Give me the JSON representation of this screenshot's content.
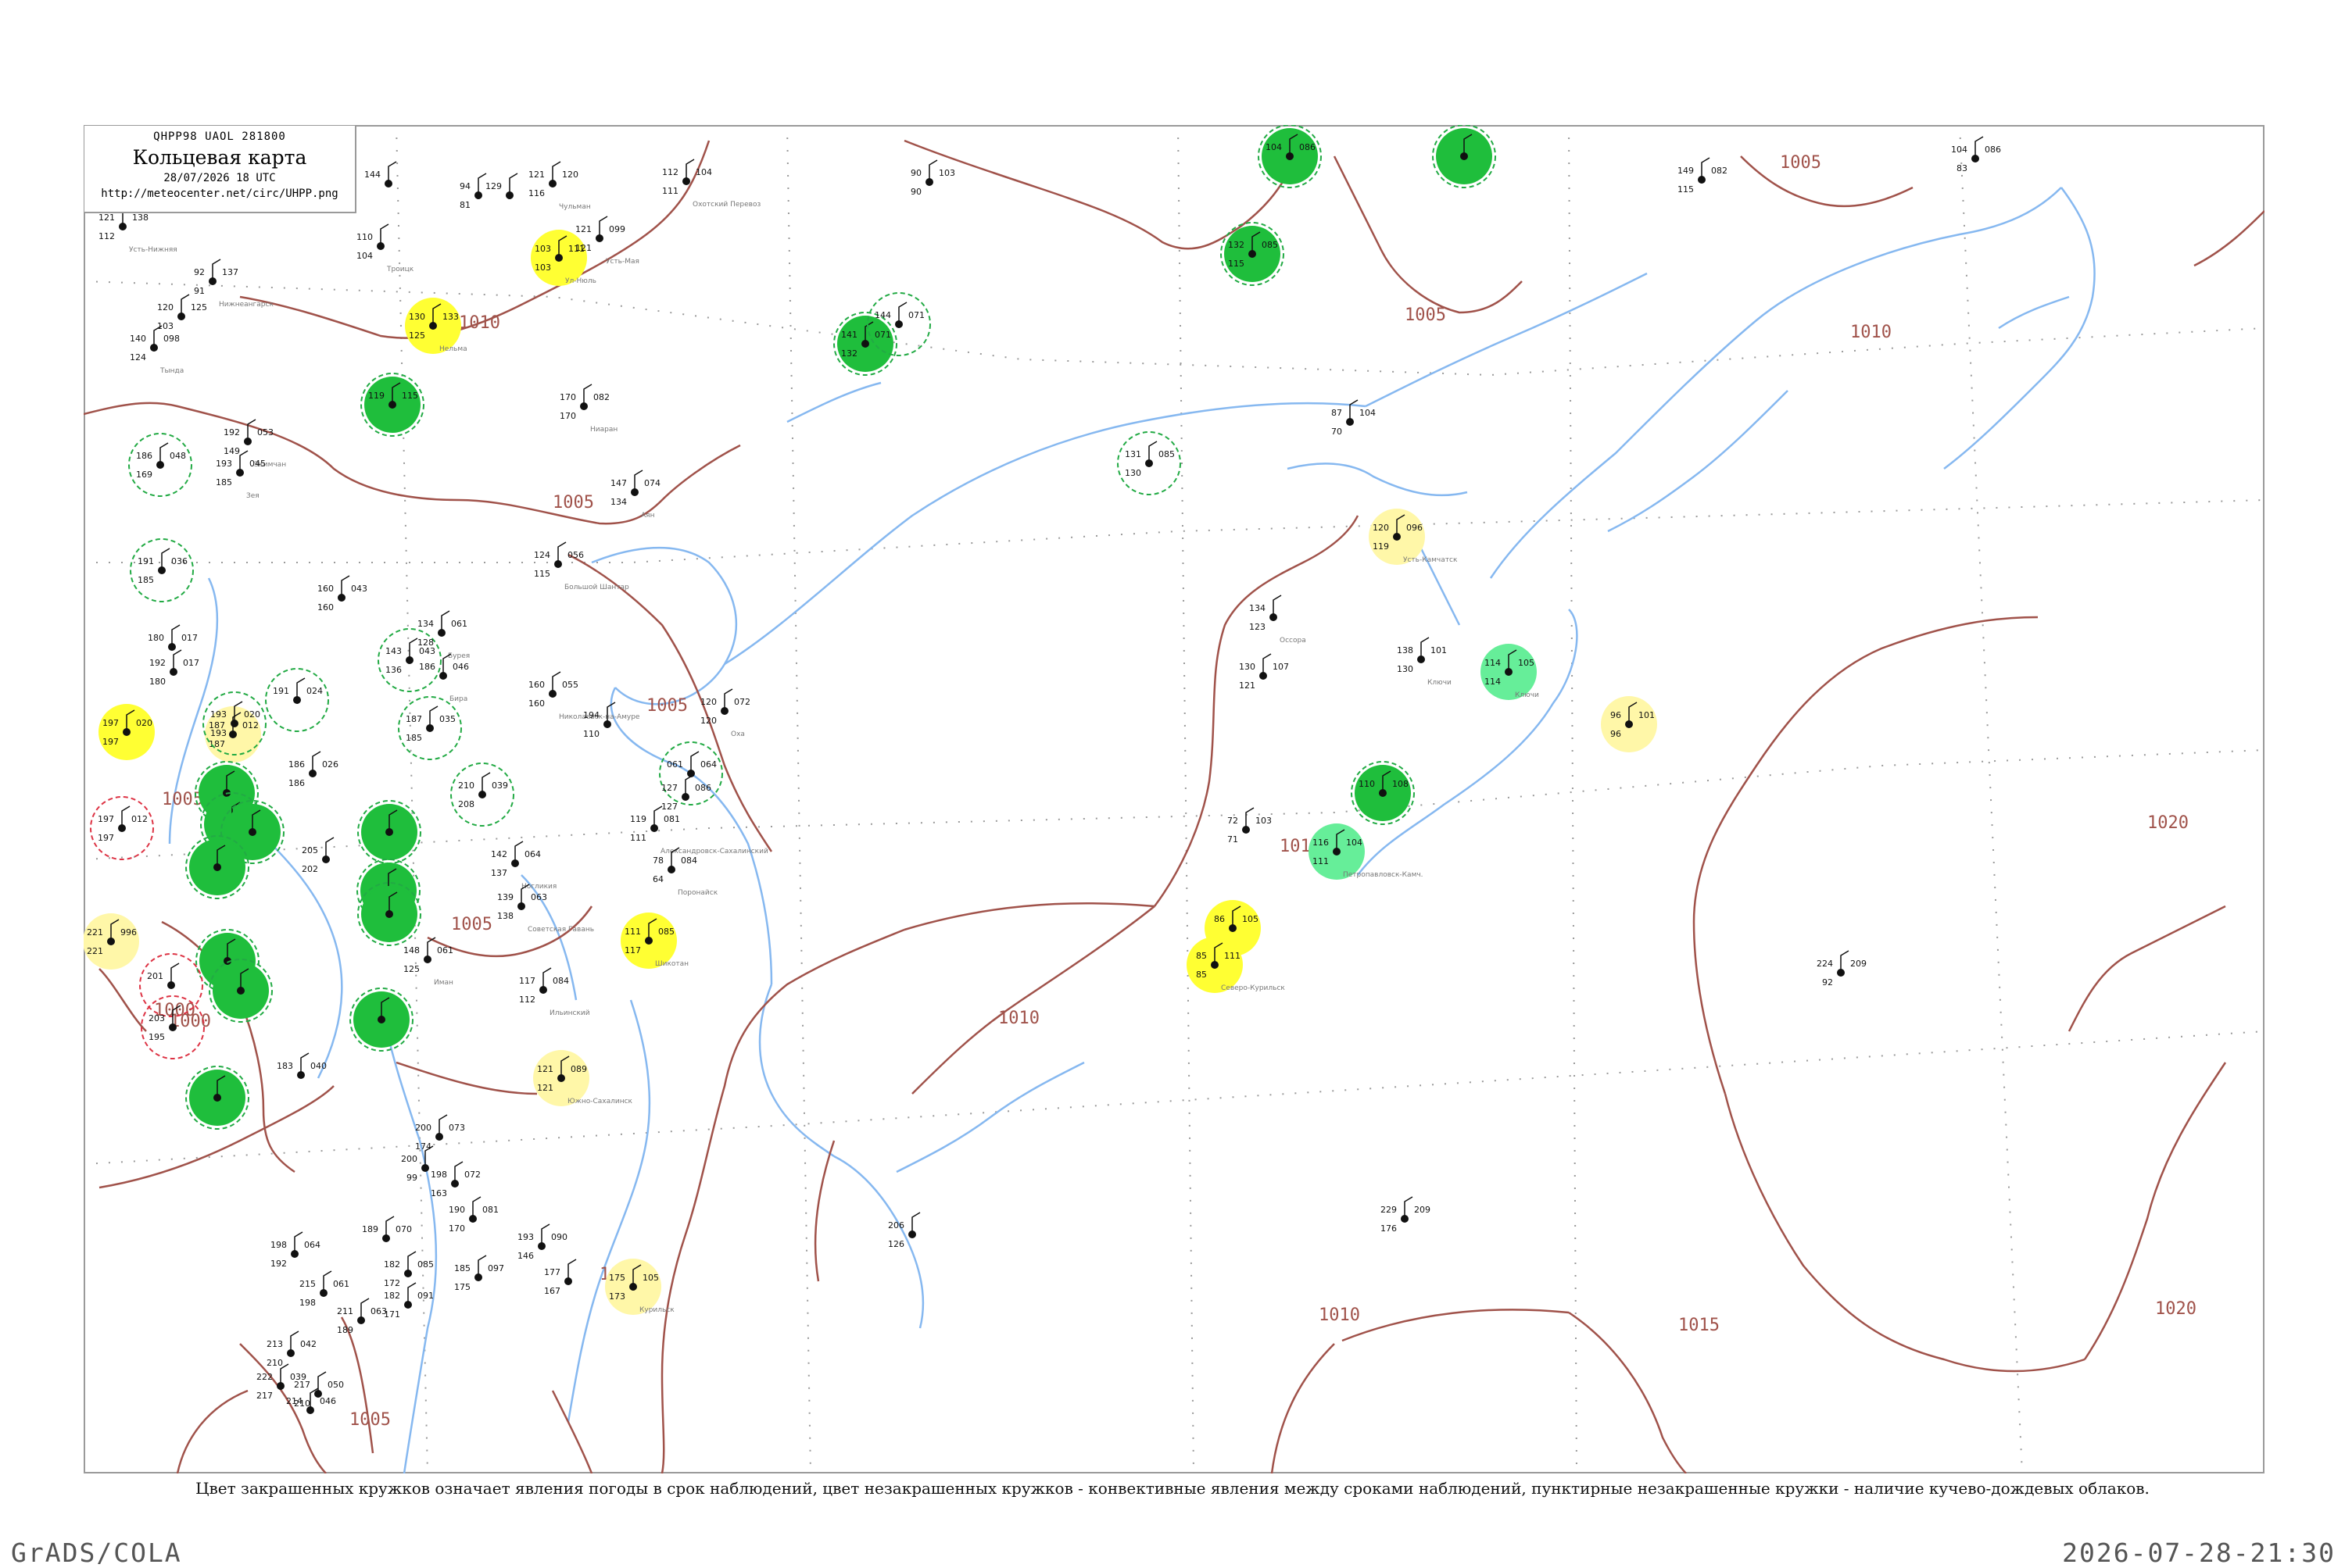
{
  "header": {
    "code": "QHPP98  UAOL  281800",
    "title": "Кольцевая карта",
    "time": "28/07/2026 18 UTC",
    "url": "http://meteocenter.net/circ/UHPP.png"
  },
  "caption": "Цвет закрашенных кружков означает явления погоды в срок наблюдений, цвет незакрашенных кружков - конвективные явления между сроками наблюдений, пунктирные незакрашенные кружки - наличие кучево-дождевых облаков.",
  "footer": {
    "left": "GrADS/COLA",
    "right": "2026-07-28-21:30"
  },
  "colors": {
    "isobar": "#a0524a",
    "coast": "#86b8f0",
    "green": "#1fbe3c",
    "yellow": "#ffff33",
    "pale_yellow": "#fff7a8",
    "light_green": "#66ee99"
  },
  "isobars": {
    "labels": [
      "1010",
      "1005",
      "1005",
      "1005",
      "1005",
      "1005",
      "1005",
      "1005",
      "1010",
      "1010",
      "1010",
      "1010",
      "1015",
      "1020",
      "1020",
      "1000",
      "1000",
      "1010"
    ]
  },
  "stations": [
    {
      "p": "130",
      "t": "133",
      "d": "125",
      "n": "Нельма",
      "fill": "yellow"
    },
    {
      "p": "103",
      "t": "111",
      "d": "103",
      "n": "Ул-Нюль",
      "fill": "yellow"
    },
    {
      "p": "119",
      "t": "115",
      "d": "",
      "n": "",
      "fill": "green"
    },
    {
      "p": "141",
      "t": "071",
      "d": "132",
      "n": "",
      "fill": "green"
    },
    {
      "p": "132",
      "t": "085",
      "d": "115",
      "n": "",
      "fill": "green"
    },
    {
      "p": "104",
      "t": "086",
      "d": "",
      "n": "",
      "fill": "green"
    },
    {
      "p": "",
      "t": "",
      "d": "",
      "n": "",
      "fill": "green"
    },
    {
      "p": "120",
      "t": "096",
      "d": "119",
      "n": "Усть-Камчатск",
      "fill": "pale_yellow"
    },
    {
      "p": "114",
      "t": "105",
      "d": "114",
      "n": "Ключи",
      "fill": "light_green"
    },
    {
      "p": "96",
      "t": "101",
      "d": "96",
      "n": "",
      "fill": "pale_yellow"
    },
    {
      "p": "110",
      "t": "108",
      "d": "",
      "n": "",
      "fill": "green"
    },
    {
      "p": "116",
      "t": "104",
      "d": "111",
      "n": "Петропавловск-Камч.",
      "fill": "light_green"
    },
    {
      "p": "86",
      "t": "105",
      "d": "",
      "n": "",
      "fill": "yellow"
    },
    {
      "p": "85",
      "t": "111",
      "d": "85",
      "n": "Северо-Курильск",
      "fill": "yellow"
    },
    {
      "p": "111",
      "t": "085",
      "d": "117",
      "n": "Шикотан",
      "fill": "yellow"
    },
    {
      "p": "121",
      "t": "089",
      "d": "121",
      "n": "Южно-Сахалинск",
      "fill": "pale_yellow"
    },
    {
      "p": "175",
      "t": "105",
      "d": "173",
      "n": "Курильск",
      "fill": "pale_yellow"
    },
    {
      "p": "197",
      "t": "020",
      "d": "197",
      "n": "",
      "fill": "yellow"
    },
    {
      "p": "187",
      "t": "012",
      "d": "187",
      "n": "",
      "fill": "pale_yellow"
    },
    {
      "p": "221",
      "t": "996",
      "d": "221",
      "n": "",
      "fill": "pale_yellow"
    },
    {
      "p": "",
      "t": "",
      "d": "",
      "n": "",
      "fill": "green"
    },
    {
      "p": "",
      "t": "",
      "d": "",
      "n": "",
      "fill": "green"
    },
    {
      "p": "",
      "t": "",
      "d": "",
      "n": "",
      "fill": "green"
    },
    {
      "p": "",
      "t": "",
      "d": "",
      "n": "",
      "fill": "green"
    },
    {
      "p": "",
      "t": "",
      "d": "",
      "n": "",
      "fill": "green"
    },
    {
      "p": "",
      "t": "",
      "d": "",
      "n": "",
      "fill": "green"
    },
    {
      "p": "",
      "t": "",
      "d": "",
      "n": "",
      "fill": "green"
    },
    {
      "p": "",
      "t": "",
      "d": "",
      "n": "",
      "fill": "green"
    },
    {
      "p": "",
      "t": "",
      "d": "",
      "n": "",
      "fill": "green"
    },
    {
      "p": "",
      "t": "",
      "d": "",
      "n": "",
      "fill": "green"
    },
    {
      "p": "",
      "t": "",
      "d": "",
      "n": "",
      "fill": "green"
    }
  ],
  "unfilled_stations": [
    {
      "p": "186",
      "t": "048",
      "d": "169",
      "n": "",
      "ring": "green"
    },
    {
      "p": "191",
      "t": "036",
      "d": "185",
      "n": "",
      "ring": "green"
    },
    {
      "p": "143",
      "t": "043",
      "d": "136",
      "n": "",
      "ring": "green"
    },
    {
      "p": "187",
      "t": "035",
      "d": "185",
      "n": "",
      "ring": "green"
    },
    {
      "p": "210",
      "t": "039",
      "d": "208",
      "n": "",
      "ring": "green"
    },
    {
      "p": "193",
      "t": "020",
      "d": "193",
      "n": "",
      "ring": "green"
    },
    {
      "p": "191",
      "t": "024",
      "d": "",
      "n": "",
      "ring": "green"
    },
    {
      "p": "131",
      "t": "085",
      "d": "130",
      "n": "",
      "ring": "green"
    },
    {
      "p": "144",
      "t": "071",
      "d": "",
      "n": "",
      "ring": "green"
    },
    {
      "p": "061",
      "t": "064",
      "d": "",
      "n": "",
      "ring": "green"
    },
    {
      "p": "197",
      "t": "012",
      "d": "197",
      "n": "",
      "ring": "red"
    },
    {
      "p": "201",
      "t": "",
      "d": "",
      "n": "",
      "ring": "red"
    },
    {
      "p": "203",
      "t": "",
      "d": "195",
      "n": "",
      "ring": "red"
    }
  ],
  "plain_stations": [
    {
      "p": "121",
      "t": "138",
      "d": "112",
      "n": "Усть-Нижняя"
    },
    {
      "p": "92",
      "t": "137",
      "d": "91",
      "n": "Нижнеангарск"
    },
    {
      "p": "120",
      "t": "125",
      "d": "103",
      "n": ""
    },
    {
      "p": "140",
      "t": "098",
      "d": "124",
      "n": "Тында"
    },
    {
      "p": "121",
      "t": "120",
      "d": "116",
      "n": "Чульман"
    },
    {
      "p": "121",
      "t": "099",
      "d": "121",
      "n": "Усть-Мая"
    },
    {
      "p": "112",
      "t": "104",
      "d": "111",
      "n": "Охотский Перевоз"
    },
    {
      "p": "90",
      "t": "103",
      "d": "90",
      "n": ""
    },
    {
      "p": "149",
      "t": "082",
      "d": "115",
      "n": ""
    },
    {
      "p": "104",
      "t": "086",
      "d": "83",
      "n": ""
    },
    {
      "p": "110",
      "t": "",
      "d": "104",
      "n": "Троицк"
    },
    {
      "p": "144",
      "t": "",
      "d": "",
      "n": ""
    },
    {
      "p": "94",
      "t": "",
      "d": "81",
      "n": ""
    },
    {
      "p": "129",
      "t": "",
      "d": "",
      "n": ""
    },
    {
      "p": "192",
      "t": "053",
      "d": "149",
      "n": "Экимчан"
    },
    {
      "p": "193",
      "t": "045",
      "d": "185",
      "n": "Зея"
    },
    {
      "p": "170",
      "t": "082",
      "d": "170",
      "n": "Ниаран"
    },
    {
      "p": "147",
      "t": "074",
      "d": "134",
      "n": "Аян"
    },
    {
      "p": "124",
      "t": "056",
      "d": "115",
      "n": "Большой Шантар"
    },
    {
      "p": "160",
      "t": "043",
      "d": "160",
      "n": ""
    },
    {
      "p": "134",
      "t": "061",
      "d": "128",
      "n": "Бурея"
    },
    {
      "p": "186",
      "t": "046",
      "d": "",
      "n": "Бира"
    },
    {
      "p": "160",
      "t": "055",
      "d": "160",
      "n": "Николаевск-на-Амуре"
    },
    {
      "p": "120",
      "t": "072",
      "d": "120",
      "n": "Оха"
    },
    {
      "p": "194",
      "t": "",
      "d": "110",
      "n": ""
    },
    {
      "p": "127",
      "t": "086",
      "d": "127",
      "n": ""
    },
    {
      "p": "119",
      "t": "081",
      "d": "111",
      "n": "Александровск-Сахалинский"
    },
    {
      "p": "142",
      "t": "064",
      "d": "137",
      "n": "Ногликия"
    },
    {
      "p": "139",
      "t": "063",
      "d": "138",
      "n": "Советская Гавань"
    },
    {
      "p": "148",
      "t": "061",
      "d": "125",
      "n": "Иман"
    },
    {
      "p": "117",
      "t": "084",
      "d": "112",
      "n": "Ильинский"
    },
    {
      "p": "78",
      "t": "084",
      "d": "64",
      "n": "Поронайск"
    },
    {
      "p": "134",
      "t": "",
      "d": "123",
      "n": "Оссора"
    },
    {
      "p": "130",
      "t": "107",
      "d": "121",
      "n": ""
    },
    {
      "p": "72",
      "t": "103",
      "d": "71",
      "n": ""
    },
    {
      "p": "138",
      "t": "101",
      "d": "130",
      "n": "Ключи"
    },
    {
      "p": "87",
      "t": "104",
      "d": "70",
      "n": ""
    },
    {
      "p": "224",
      "t": "209",
      "d": "92",
      "n": ""
    },
    {
      "p": "229",
      "t": "209",
      "d": "176",
      "n": ""
    },
    {
      "p": "206",
      "t": "",
      "d": "126",
      "n": ""
    },
    {
      "p": "183",
      "t": "040",
      "d": "",
      "n": ""
    },
    {
      "p": "200",
      "t": "073",
      "d": "174",
      "n": ""
    },
    {
      "p": "200",
      "t": "",
      "d": "99",
      "n": ""
    },
    {
      "p": "198",
      "t": "072",
      "d": "163",
      "n": ""
    },
    {
      "p": "190",
      "t": "081",
      "d": "170",
      "n": ""
    },
    {
      "p": "193",
      "t": "090",
      "d": "146",
      "n": ""
    },
    {
      "p": "185",
      "t": "097",
      "d": "175",
      "n": ""
    },
    {
      "p": "177",
      "t": "",
      "d": "167",
      "n": ""
    },
    {
      "p": "198",
      "t": "064",
      "d": "192",
      "n": ""
    },
    {
      "p": "215",
      "t": "061",
      "d": "198",
      "n": ""
    },
    {
      "p": "211",
      "t": "063",
      "d": "189",
      "n": ""
    },
    {
      "p": "189",
      "t": "070",
      "d": "",
      "n": ""
    },
    {
      "p": "182",
      "t": "085",
      "d": "172",
      "n": ""
    },
    {
      "p": "182",
      "t": "091",
      "d": "171",
      "n": ""
    },
    {
      "p": "213",
      "t": "042",
      "d": "210",
      "n": ""
    },
    {
      "p": "222",
      "t": "039",
      "d": "217",
      "n": ""
    },
    {
      "p": "217",
      "t": "050",
      "d": "210",
      "n": ""
    },
    {
      "p": "214",
      "t": "046",
      "d": "",
      "n": ""
    },
    {
      "p": "180",
      "t": "017",
      "d": "",
      "n": ""
    },
    {
      "p": "192",
      "t": "017",
      "d": "180",
      "n": ""
    },
    {
      "p": "186",
      "t": "026",
      "d": "186",
      "n": ""
    },
    {
      "p": "205",
      "t": "",
      "d": "202",
      "n": ""
    }
  ]
}
